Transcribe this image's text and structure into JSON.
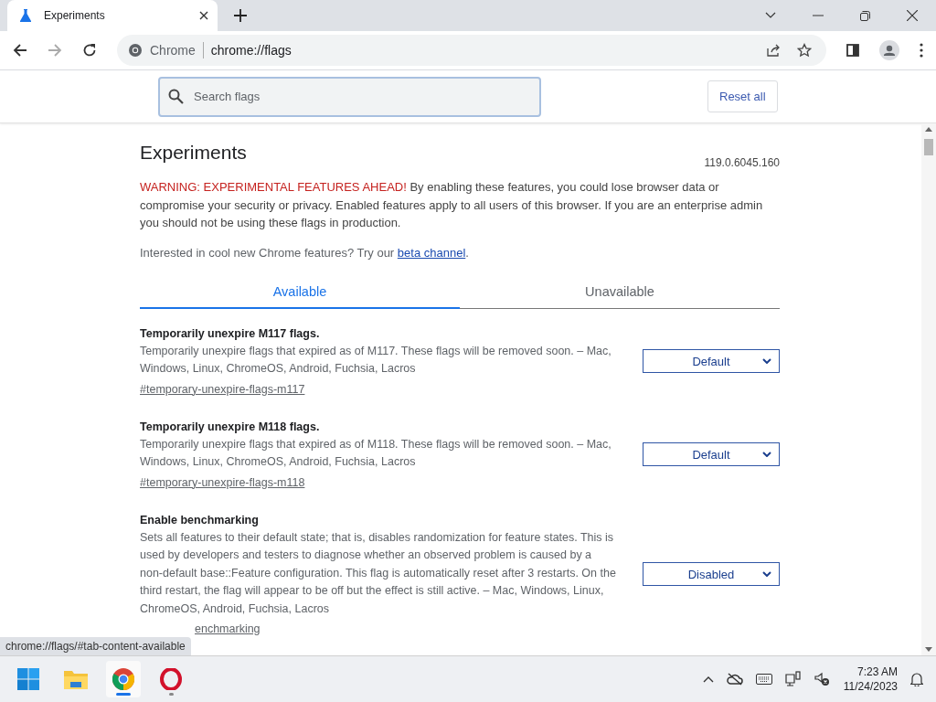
{
  "browser_tabs": [
    {
      "title": "Experiments",
      "selected": true
    }
  ],
  "address_bar": {
    "site_label": "Chrome",
    "url": "chrome://flags"
  },
  "search": {
    "placeholder": "Search flags"
  },
  "reset_button": "Reset all",
  "page": {
    "title": "Experiments",
    "version": "119.0.6045.160",
    "warning_lead": "WARNING: EXPERIMENTAL FEATURES AHEAD!",
    "warning_text": "By enabling these features, you could lose browser data or compromise your security or privacy. Enabled features apply to all users of this browser. If you are an enterprise admin you should not be using these flags in production.",
    "interest_text": "Interested in cool new Chrome features? Try our",
    "interest_link": "beta channel",
    "interest_end": "."
  },
  "content_tabs": [
    {
      "label": "Available",
      "selected": true
    },
    {
      "label": "Unavailable",
      "selected": false
    }
  ],
  "flags": [
    {
      "name": "Temporarily unexpire M117 flags.",
      "description": "Temporarily unexpire flags that expired as of M117. These flags will be removed soon. – Mac, Windows, Linux, ChromeOS, Android, Fuchsia, Lacros",
      "link": "#temporary-unexpire-flags-m117",
      "value": "Default"
    },
    {
      "name": "Temporarily unexpire M118 flags.",
      "description": "Temporarily unexpire flags that expired as of M118. These flags will be removed soon. – Mac, Windows, Linux, ChromeOS, Android, Fuchsia, Lacros",
      "link": "#temporary-unexpire-flags-m118",
      "value": "Default"
    },
    {
      "name": "Enable benchmarking",
      "description": "Sets all features to their default state; that is, disables randomization for feature states. This is used by developers and testers to diagnose whether an observed problem is caused by a non-default base::Feature configuration. This flag is automatically reset after 3 restarts. On the third restart, the flag will appear to be off but the effect is still active. – Mac, Windows, Linux, ChromeOS, Android, Fuchsia, Lacros",
      "link": "enchmarking",
      "value": "Disabled"
    }
  ],
  "status_bubble": "chrome://flags/#tab-content-available",
  "taskbar": {
    "apps": [
      {
        "kind": "start",
        "selected": false,
        "running": false
      },
      {
        "kind": "folder",
        "selected": false,
        "running": false
      },
      {
        "kind": "chrome",
        "selected": true,
        "running": true
      },
      {
        "kind": "opera",
        "selected": false,
        "running": true
      }
    ],
    "time": "7:23 AM",
    "date": "11/24/2023"
  }
}
